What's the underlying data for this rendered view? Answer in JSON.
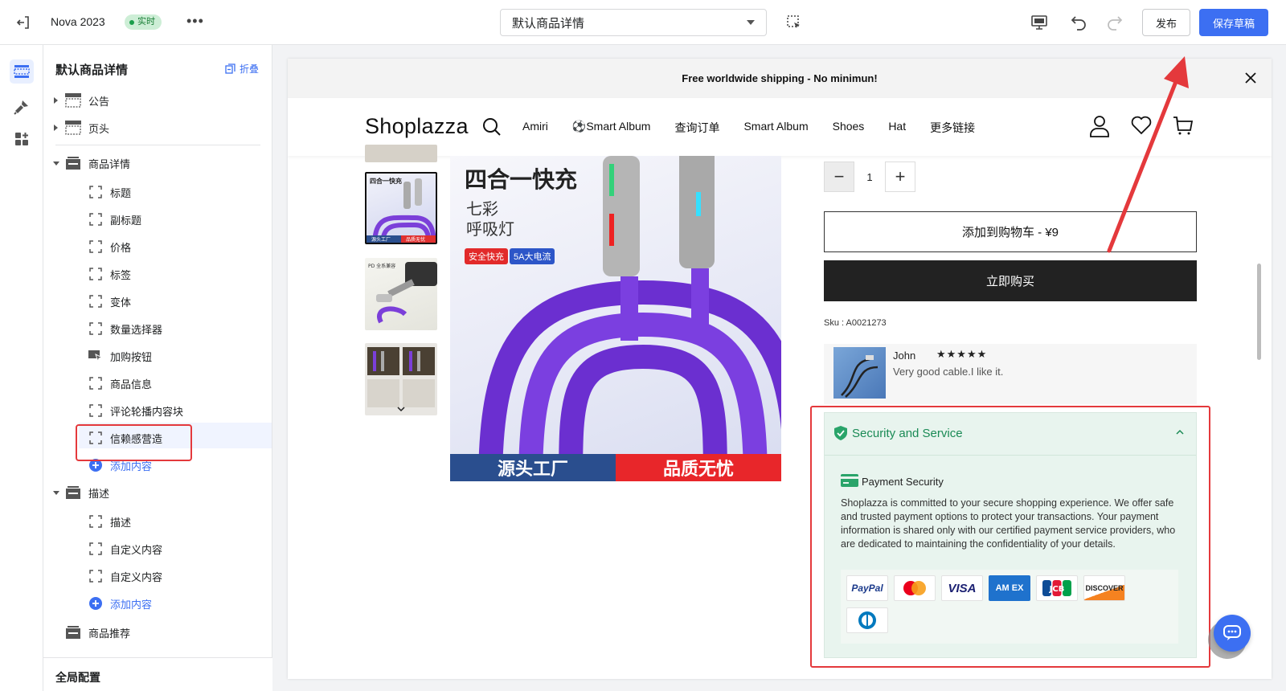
{
  "topbar": {
    "store_name": "Nova 2023",
    "live_badge": "实时",
    "more": "•••",
    "template_select": "默认商品详情",
    "publish_label": "发布",
    "save_label": "保存草稿"
  },
  "sidebar": {
    "title": "默认商品详情",
    "collapse_label": "折叠",
    "sections": [
      {
        "label": "公告"
      },
      {
        "label": "页头"
      },
      {
        "label": "商品详情",
        "children": [
          "标题",
          "副标题",
          "价格",
          "标签",
          "变体",
          "数量选择器",
          "加购按钮",
          "商品信息",
          "评论轮播内容块",
          "信赖感营造"
        ],
        "add": "添加内容"
      },
      {
        "label": "描述",
        "children": [
          "描述",
          "自定义内容",
          "自定义内容"
        ],
        "add": "添加内容"
      },
      {
        "label": "商品推荐"
      }
    ],
    "footer": "全局配置"
  },
  "preview": {
    "announcement": "Free worldwide shipping - No minimun!",
    "logo": "Shoplazza",
    "nav": [
      "Amiri",
      "⚽Smart Album",
      "查询订单",
      "Smart Album",
      "Shoes",
      "Hat",
      "更多链接"
    ],
    "main_image": {
      "title": "四合一快充",
      "subtitle_1": "七彩",
      "subtitle_2": "呼吸灯",
      "tag_1": "安全快充",
      "tag_2": "5A大电流",
      "banner_left": "源头工厂",
      "banner_right": "品质无忧"
    },
    "thumb_labels": {
      "t1_title": "四合一快充",
      "t1_banner_left": "源头工厂",
      "t1_banner_right": "品质无忧",
      "t2_title": "PD 全系兼容"
    },
    "quantity": "1",
    "add_to_cart": "添加到购物车  -  ¥9",
    "buy_now": "立即购买",
    "sku": "Sku : A0021273",
    "review": {
      "name": "John",
      "stars": "★★★★★",
      "rating": 5,
      "text": "Very good cable.I like it."
    },
    "security": {
      "title": "Security and Service",
      "subtitle": "Payment Security",
      "body": "Shoplazza is committed to your secure shopping experience. We offer safe and trusted payment options to protect your transactions. Your payment information is shared only with our certified payment service providers, who are dedicated to maintaining the confidentiality of your details.",
      "payment_methods": [
        "PayPal",
        "Mastercard",
        "VISA",
        "AMEX",
        "JCB",
        "DISCOVER",
        "Diners Club"
      ],
      "paypal_label": "PayPal",
      "visa_label": "VISA",
      "amex_label": "AM EX",
      "jcb_label": "JCB",
      "discover_label": "DISCOVER"
    }
  },
  "colors": {
    "accent": "#3c6ff2",
    "live_green": "#1a7f37",
    "security_green": "#1a8a55",
    "annotation_red": "#e4393c"
  }
}
